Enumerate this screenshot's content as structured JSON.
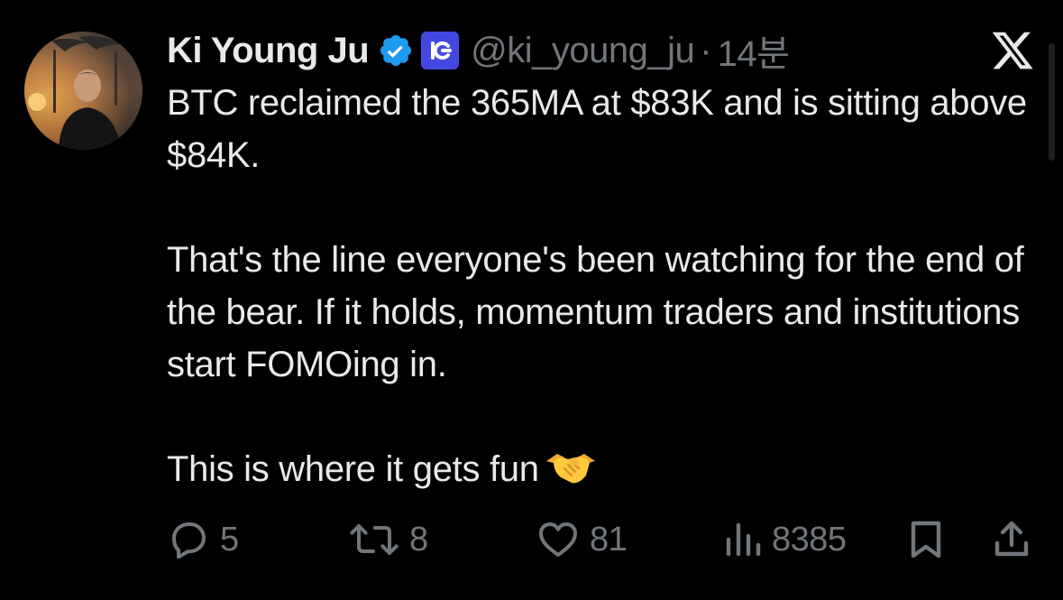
{
  "author": {
    "name": "Ki Young Ju",
    "handle": "@ki_young_ju",
    "separator": "·",
    "time": "14분"
  },
  "icons": {
    "verified": "verified-badge-icon",
    "affiliate": "cryptoquant-affiliate-icon",
    "platform": "x-logo-icon",
    "emoji": "handshake-emoji",
    "reply": "reply-icon",
    "retweet": "retweet-icon",
    "like": "heart-icon",
    "views": "views-icon",
    "bookmark": "bookmark-icon",
    "share": "share-icon"
  },
  "colors": {
    "background": "#000000",
    "text": "#e7e9ea",
    "muted": "#71767b",
    "verified": "#1d9bf0",
    "affiliate": "#4548e0"
  },
  "tweet": {
    "paragraphs": [
      "BTC reclaimed the 365MA at $83K and is sitting above $84K.",
      "That's the line everyone's been watching for the end of the bear. If it holds, momentum traders and institutions start FOMOing in.",
      "This is where it gets fun"
    ],
    "emoji": "🤝"
  },
  "metrics": {
    "replies": "5",
    "retweets": "8",
    "likes": "81",
    "views": "8385"
  }
}
